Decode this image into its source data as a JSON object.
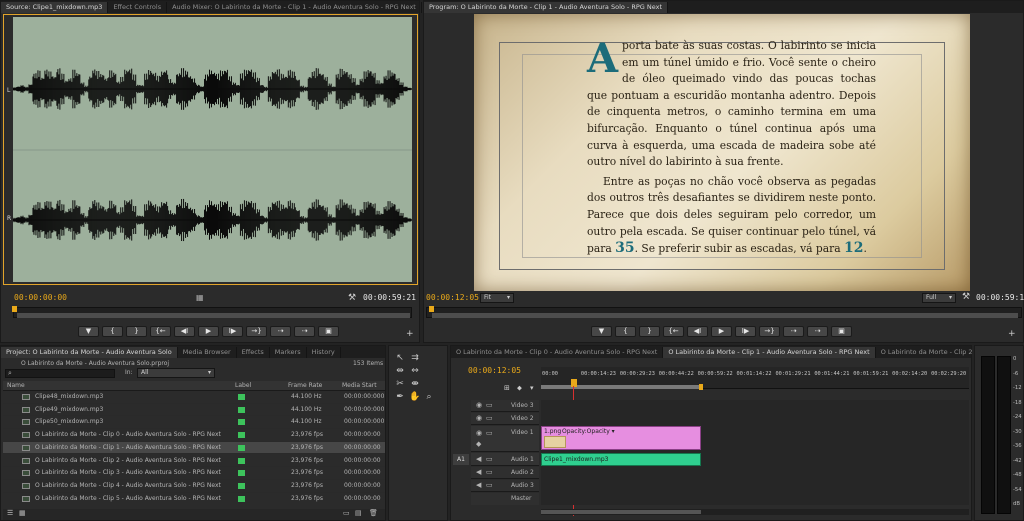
{
  "source_panel": {
    "tabs": [
      "Source: Clipe1_mixdown.mp3",
      "Effect Controls",
      "Audio Mixer: O Labirinto da Morte - Clip 1 - Audio Aventura Solo - RPG Next"
    ],
    "channel_labels": [
      "L",
      "R"
    ],
    "timecode_in": "00:00:00:00",
    "timecode_duration": "00:00:59:21",
    "controls": [
      "▼",
      "{",
      "}",
      "{←",
      "◀I",
      "▶",
      "I▶",
      "→}",
      "⇢",
      "⇢",
      "▣"
    ],
    "waveform_top": [
      0.08,
      0.12,
      0.18,
      0.1,
      0.22,
      0.72,
      0.85,
      0.55,
      0.9,
      0.8,
      0.6,
      0.95,
      0.7,
      0.4,
      0.5,
      0.88,
      0.75,
      0.3,
      0.15,
      0.6,
      0.92,
      0.82,
      0.7,
      0.5,
      0.85,
      0.78,
      0.35,
      0.55,
      0.9,
      0.95,
      0.66,
      0.2,
      0.18,
      0.7,
      0.88,
      0.76,
      0.6,
      0.82,
      0.9,
      0.45,
      0.3,
      0.74,
      0.95,
      0.86,
      0.62,
      0.48,
      0.2,
      0.12,
      0.66,
      0.9,
      0.8,
      0.7,
      0.85,
      0.92,
      0.58,
      0.3,
      0.2,
      0.72,
      0.88,
      0.94,
      0.76,
      0.52,
      0.2,
      0.1,
      0.58,
      0.84,
      0.9,
      0.7,
      0.62,
      0.88,
      0.8,
      0.46,
      0.15,
      0.1,
      0.6,
      0.82,
      0.95,
      0.74,
      0.55,
      0.25,
      0.12,
      0.7,
      0.92,
      0.86,
      0.68,
      0.5,
      0.22,
      0.48,
      0.8,
      0.9,
      0.74,
      0.4,
      0.3,
      0.62,
      0.85,
      0.78,
      0.5,
      0.3,
      0.12,
      0.06
    ],
    "waveform_bottom": [
      0.1,
      0.14,
      0.2,
      0.12,
      0.25,
      0.7,
      0.82,
      0.6,
      0.88,
      0.84,
      0.58,
      0.92,
      0.72,
      0.42,
      0.55,
      0.9,
      0.7,
      0.32,
      0.18,
      0.62,
      0.94,
      0.8,
      0.68,
      0.52,
      0.88,
      0.76,
      0.38,
      0.58,
      0.92,
      0.96,
      0.64,
      0.22,
      0.2,
      0.72,
      0.9,
      0.74,
      0.62,
      0.84,
      0.88,
      0.44,
      0.32,
      0.76,
      0.96,
      0.84,
      0.6,
      0.5,
      0.22,
      0.14,
      0.68,
      0.92,
      0.78,
      0.72,
      0.86,
      0.9,
      0.6,
      0.32,
      0.22,
      0.74,
      0.9,
      0.92,
      0.78,
      0.5,
      0.22,
      0.12,
      0.6,
      0.86,
      0.88,
      0.72,
      0.64,
      0.9,
      0.78,
      0.48,
      0.18,
      0.12,
      0.62,
      0.84,
      0.94,
      0.72,
      0.58,
      0.26,
      0.14,
      0.72,
      0.94,
      0.84,
      0.7,
      0.52,
      0.24,
      0.5,
      0.82,
      0.88,
      0.76,
      0.42,
      0.32,
      0.64,
      0.86,
      0.8,
      0.52,
      0.32,
      0.14,
      0.08
    ]
  },
  "program_panel": {
    "tab": "Program: O Labirinto da Morte - Clip 1 - Audio Aventura Solo - RPG Next",
    "timecode_current": "00:00:12:05",
    "fit": "Fit",
    "quality": "Full",
    "timecode_duration": "00:00:59:18",
    "page": {
      "dropcap": "A",
      "p1": "porta bate às suas costas. O labirinto se inicia em um túnel úmido e frio. Você sente o cheiro de óleo queimado vindo das poucas tochas que pontuam a escuridão montanha adentro. Depois de cinquenta metros, o caminho termina em uma bifurcação. Enquanto o túnel continua após uma curva à esquerda, uma escada de madeira sobe até outro nível do labirinto à sua frente.",
      "p2a": "Entre as poças no chão você observa as pegadas dos outros três desafiantes se dividirem neste ponto. Parece que dois deles seguiram pelo corredor, um outro pela escada. Se quiser continuar pelo túnel, vá para",
      "link1": "35",
      "p2b": ". Se preferir subir as escadas, vá para",
      "link2": "12",
      "p2c": "."
    }
  },
  "project_panel": {
    "tabs": [
      "Project: O Labirinto da Morte - Audio Aventura Solo",
      "Media Browser",
      "Effects",
      "Markers",
      "History"
    ],
    "project_file": "O Labirinto da Morte - Audio Aventura Solo.prproj",
    "item_count": "153 Items",
    "in_label": "In:",
    "in_value": "All",
    "columns": [
      "Name",
      "Label",
      "Frame Rate",
      "Media Start"
    ],
    "rows": [
      {
        "name": "Clipe48_mixdown.mp3",
        "rate": "44.100 Hz",
        "start": "00:00:00:000",
        "selected": false
      },
      {
        "name": "Clipe49_mixdown.mp3",
        "rate": "44.100 Hz",
        "start": "00:00:00:000",
        "selected": false
      },
      {
        "name": "Clipe50_mixdown.mp3",
        "rate": "44.100 Hz",
        "start": "00:00:00:000",
        "selected": false
      },
      {
        "name": "O Labirinto da Morte - Clip 0 - Audio Aventura Solo - RPG Next",
        "rate": "23,976 fps",
        "start": "00:00:00:00",
        "selected": false
      },
      {
        "name": "O Labirinto da Morte - Clip 1 - Audio Aventura Solo - RPG Next",
        "rate": "23,976 fps",
        "start": "00:00:00:00",
        "selected": true
      },
      {
        "name": "O Labirinto da Morte - Clip 2 - Audio Aventura Solo - RPG Next",
        "rate": "23,976 fps",
        "start": "00:00:00:00",
        "selected": false
      },
      {
        "name": "O Labirinto da Morte - Clip 3 - Audio Aventura Solo - RPG Next",
        "rate": "23,976 fps",
        "start": "00:00:00:00",
        "selected": false
      },
      {
        "name": "O Labirinto da Morte - Clip 4 - Audio Aventura Solo - RPG Next",
        "rate": "23,976 fps",
        "start": "00:00:00:00",
        "selected": false
      },
      {
        "name": "O Labirinto da Morte - Clip 5 - Audio Aventura Solo - RPG Next",
        "rate": "23,976 fps",
        "start": "00:00:00:00",
        "selected": false
      }
    ]
  },
  "timeline_panel": {
    "tabs": [
      "O Labirinto da Morte - Clip 0 - Audio Aventura Solo - RPG Next",
      "O Labirinto da Morte - Clip 1 - Audio Aventura Solo - RPG Next",
      "O Labirinto da Morte - Clip 2 - Audio Aventura 1"
    ],
    "timecode": "00:00:12:05",
    "ruler": [
      "00:00",
      "00:00:14:23",
      "00:00:29:23",
      "00:00:44:22",
      "00:00:59:22",
      "00:01:14:22",
      "00:01:29:21",
      "00:01:44:21",
      "00:01:59:21",
      "00:02:14:20",
      "00:02:29:20"
    ],
    "tracks": {
      "video3": "Video 3",
      "video2": "Video 2",
      "video1": "Video 1",
      "a1_target": "A1",
      "audio1": "Audio 1",
      "audio2": "Audio 2",
      "audio3": "Audio 3",
      "master": "Master"
    },
    "video_clip": "1.png",
    "video_clip_fx": "Opacity:Opacity ▾",
    "audio_clip": "Clipe1_mixdown.mp3"
  },
  "vu_meter": {
    "scale": [
      "0",
      "-6",
      "-12",
      "-18",
      "-24",
      "-30",
      "-36",
      "-42",
      "-48",
      "-54",
      "dB"
    ]
  },
  "colors": {
    "accent_timecode": "#e9a91a",
    "label_green": "#3dc35c",
    "video_clip": "#e68ee0",
    "audio_clip": "#2fcf8f",
    "waveform_bg": "#9db09c",
    "playhead": "#d83030"
  }
}
